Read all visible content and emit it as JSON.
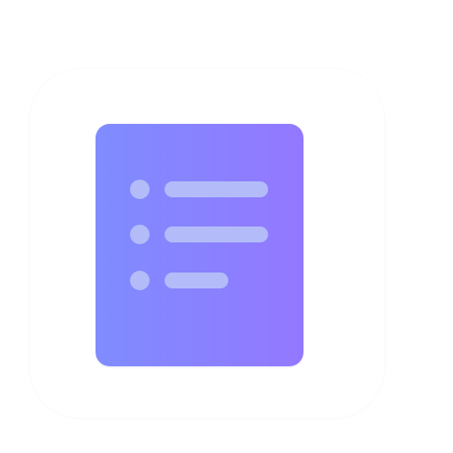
{
  "icon": {
    "name": "document-list-icon",
    "tile_color": "#ffffff",
    "card_gradient": [
      "#7f8cff",
      "#9378ff"
    ],
    "item_color": "#b3bcf8",
    "list_items": [
      {
        "bullet": "dot",
        "line": "long"
      },
      {
        "bullet": "dot",
        "line": "long"
      },
      {
        "bullet": "dot",
        "line": "short"
      }
    ]
  }
}
